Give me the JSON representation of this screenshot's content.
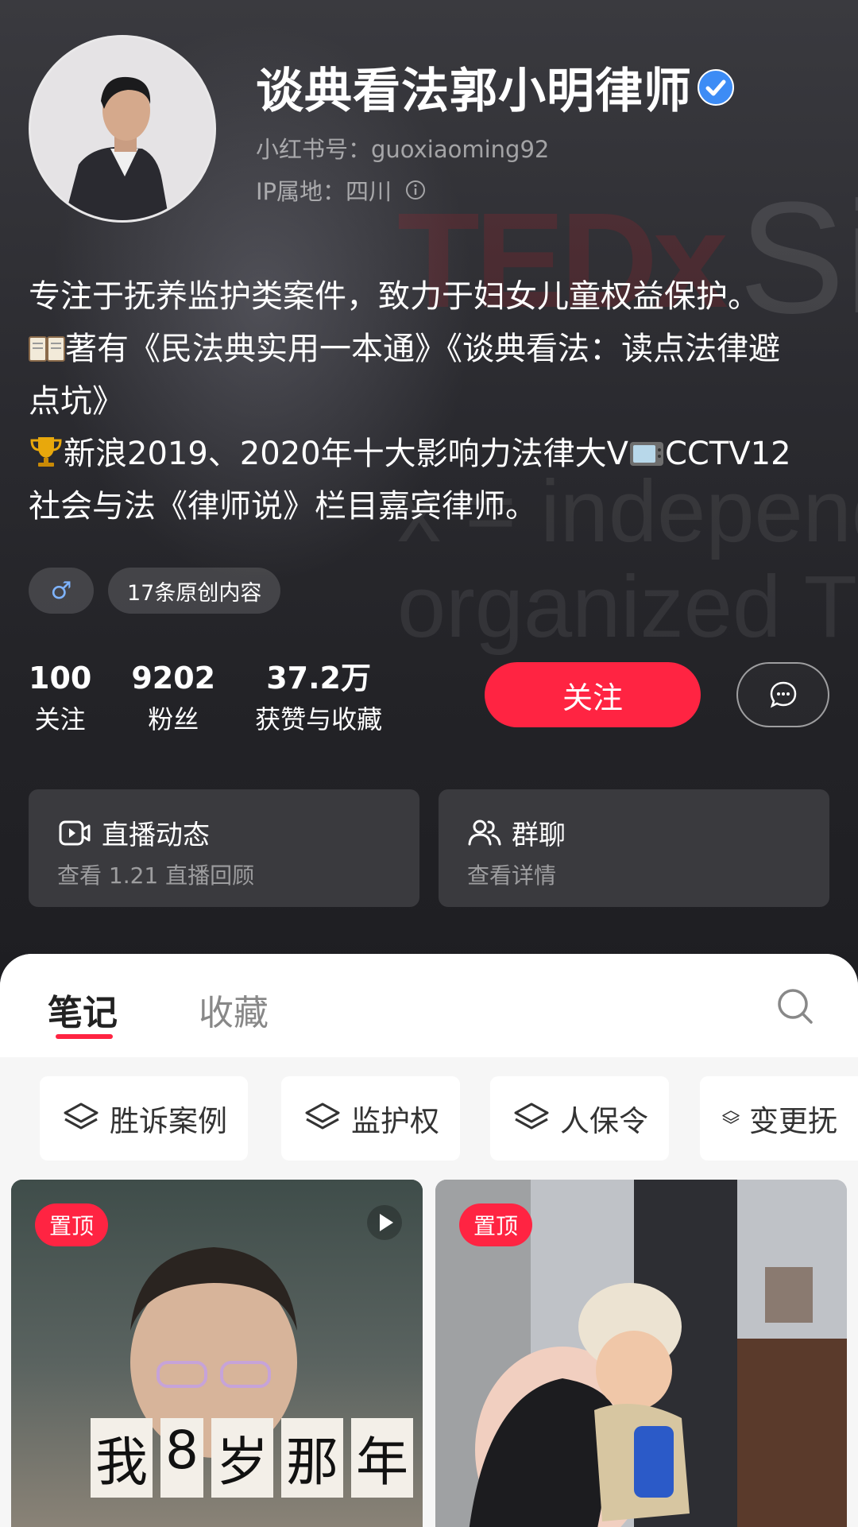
{
  "profile": {
    "name": "谈典看法郭小明律师",
    "red_id": "小红书号：guoxiaoming92",
    "ip": "IP属地：四川",
    "bio": [
      "专注于抚养监护类案件，致力于妇女儿童权益保护。",
      "著有《民法典实用一本通》《谈典看法：读点法律避",
      "点坑》",
      "新浪2019、2020年十大影响力法律大V",
      "CCTV12",
      "社会与法《律师说》栏目嘉宾律师。"
    ],
    "tags": {
      "gender": "♂",
      "original": "17条原创内容"
    },
    "stats": [
      {
        "num": "100",
        "label": "关注"
      },
      {
        "num": "9202",
        "label": "粉丝"
      },
      {
        "num": "37.2万",
        "label": "获赞与收藏"
      }
    ],
    "follow_label": "关注"
  },
  "cards": {
    "live": {
      "title": "直播动态",
      "sub": "查看 1.21 直播回顾"
    },
    "group": {
      "title": "群聊",
      "sub": "查看详情"
    }
  },
  "tabs": {
    "notes": "笔记",
    "collect": "收藏"
  },
  "chips": [
    "胜诉案例",
    "监护权",
    "人保令",
    "变更抚"
  ],
  "feed": {
    "pin_label": "置顶",
    "left_overlay": [
      "我",
      "8",
      "岁",
      "那",
      "年"
    ]
  },
  "background_text": {
    "ted": "TEDx",
    "si": "Si",
    "line1": "x = independent",
    "line2": "organized TED"
  },
  "colors": {
    "accent": "#ff2442",
    "verified": "#3d8cf5"
  },
  "icons": {
    "verified": "verified-badge-icon",
    "info": "info-icon",
    "message": "message-icon",
    "live": "live-video-icon",
    "group": "group-users-icon",
    "search": "search-icon",
    "chip": "layers-icon",
    "play": "play-icon"
  }
}
